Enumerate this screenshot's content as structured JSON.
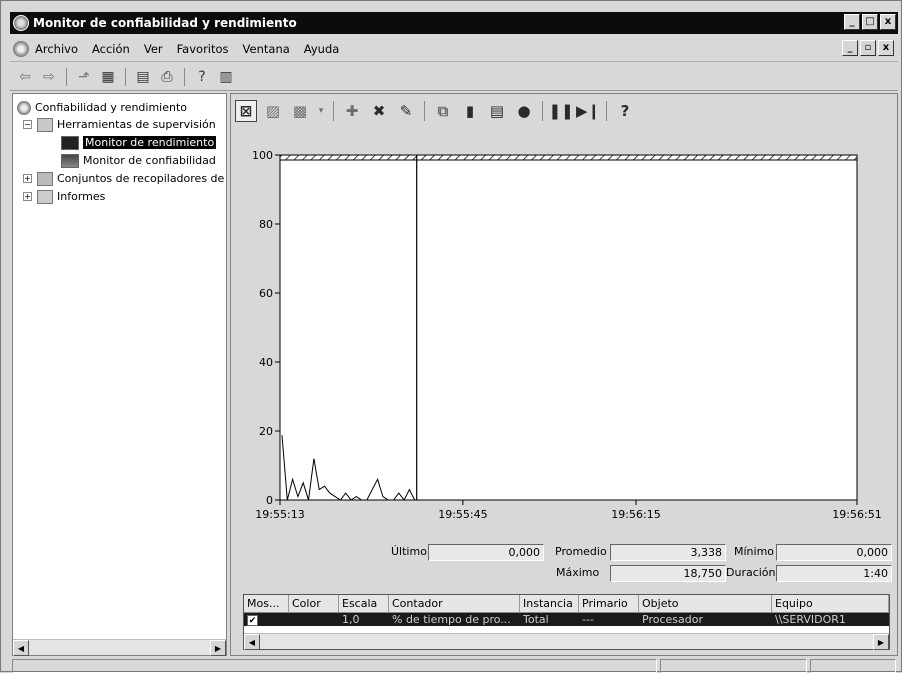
{
  "window": {
    "title": "Monitor de confiabilidad y rendimiento",
    "controls": {
      "minimize": "_",
      "restore": "□",
      "close": "x"
    }
  },
  "menu": {
    "items": [
      "Archivo",
      "Acción",
      "Ver",
      "Favoritos",
      "Ventana",
      "Ayuda"
    ],
    "mdi_controls": {
      "minimize": "_",
      "restore": "▫",
      "close": "x"
    }
  },
  "tree": {
    "root": "Confiabilidad y rendimiento",
    "tools": "Herramientas de supervisión",
    "perf_monitor": "Monitor de rendimiento",
    "rel_monitor": "Monitor de confiabilidad",
    "collector_sets": "Conjuntos de recopiladores de",
    "reports": "Informes",
    "expand_minus": "−",
    "expand_plus": "+"
  },
  "chart_data": {
    "type": "line",
    "ylim": [
      0,
      100
    ],
    "y_ticks": [
      "100",
      "80",
      "60",
      "40",
      "20",
      "0"
    ],
    "x_ticks": [
      "19:55:13",
      "19:55:45",
      "19:56:15",
      "19:56:51"
    ],
    "series": [
      {
        "values": [
          18.75,
          0,
          6,
          1,
          5,
          0,
          12,
          3,
          4,
          2,
          1,
          0,
          2,
          0,
          1,
          0,
          0,
          3,
          6,
          1,
          0,
          0,
          2,
          0,
          3,
          0
        ]
      }
    ],
    "cursor_position": 0.23,
    "colors": {
      "line": "#000000",
      "background": "#ffffff"
    }
  },
  "stats": {
    "last_label": "Último",
    "last_value": "0,000",
    "avg_label": "Promedio",
    "avg_value": "3,338",
    "min_label": "Mínimo",
    "min_value": "0,000",
    "max_label": "Máximo",
    "max_value": "18,750",
    "duration_label": "Duración",
    "duration_value": "1:40"
  },
  "counters": {
    "headers": [
      "Mos...",
      "Color",
      "Escala",
      "Contador",
      "Instancia",
      "Primario",
      "Objeto",
      "Equipo"
    ],
    "row": {
      "show": "✔",
      "color": "",
      "scale": "1,0",
      "counter": "% de tiempo de pro...",
      "instance": "Total",
      "parent": "---",
      "object": "Procesador",
      "computer": "\\\\SERVIDOR1"
    }
  },
  "scroll": {
    "left": "◀",
    "right": "▶"
  }
}
